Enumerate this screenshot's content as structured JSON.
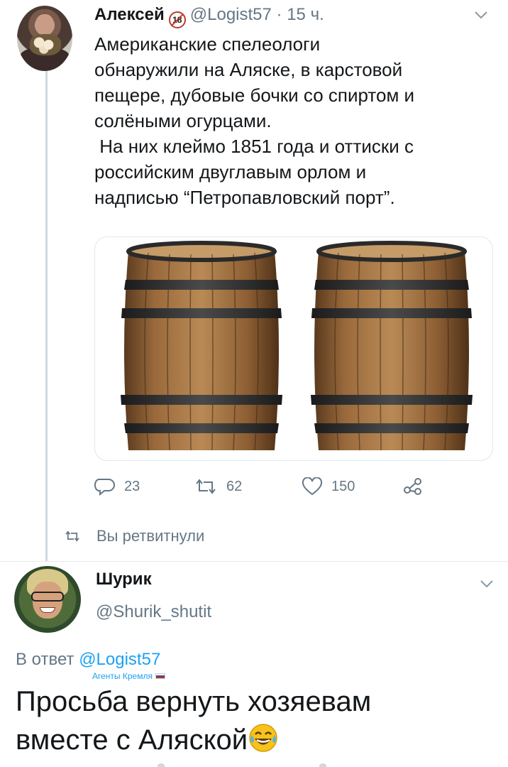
{
  "tweet": {
    "author_name": "Алексей",
    "badge": "18",
    "handle": "@Logist57",
    "separator": " · ",
    "time": "15 ч.",
    "text_paragraph_1": "Американские спелеологи\nобнаружили на Аляске, в карстовой\nпещере, дубовые бочки со спиртом и\nсолёными огурцами.",
    "text_paragraph_2": " На них клеймо 1851 года и оттиски с\nроссийским двуглавым орлом и\nнадписью “Петропавловский порт”.",
    "replies": "23",
    "retweets": "62",
    "likes": "150",
    "icons": [
      "reply-icon",
      "retweet-icon",
      "like-icon",
      "share-icon",
      "chevron-down-icon"
    ],
    "retweeted_note": "Вы ретвитнули"
  },
  "reply": {
    "author_name": "Шурик",
    "handle": "@Shurik_shutit",
    "reply_prefix": "В ответ ",
    "reply_mention": "@Logist57",
    "mention_tag": "Агенты Кремля",
    "text": "Просьба вернуть хозяевам\nвместе с Аляской",
    "emoji": "tears-of-joy-emoji"
  },
  "colors": {
    "text": "#14171a",
    "muted": "#657786",
    "link": "#1da1f2",
    "divider": "#e6ecf0"
  }
}
